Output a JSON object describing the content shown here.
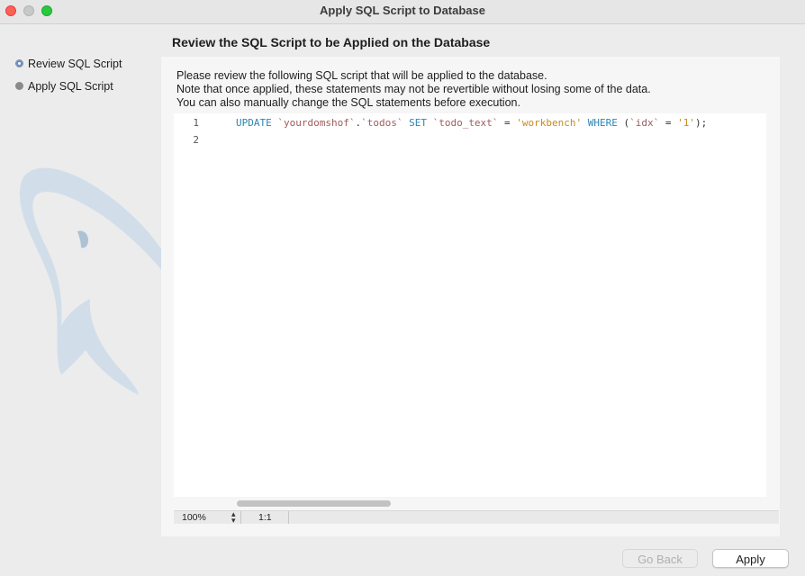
{
  "window": {
    "title": "Apply SQL Script to Database"
  },
  "sidebar": {
    "steps": [
      {
        "label": "Review SQL Script",
        "active": true
      },
      {
        "label": "Apply SQL Script",
        "active": false
      }
    ]
  },
  "main": {
    "heading": "Review the SQL Script to be Applied on the Database",
    "description": [
      "Please review the following SQL script that will be applied to the database.",
      "Note that once applied, these statements may not be revertible without losing some of the data.",
      "You can also manually change the SQL statements before execution."
    ]
  },
  "editor": {
    "line_numbers": [
      "1",
      "2"
    ],
    "tokens": [
      {
        "text": "UPDATE",
        "kind": "keyword"
      },
      {
        "text": " ",
        "kind": "plain"
      },
      {
        "text": "`yourdomshof`",
        "kind": "identifier"
      },
      {
        "text": ".",
        "kind": "plain"
      },
      {
        "text": "`todos`",
        "kind": "identifier"
      },
      {
        "text": " ",
        "kind": "plain"
      },
      {
        "text": "SET",
        "kind": "keyword"
      },
      {
        "text": " ",
        "kind": "plain"
      },
      {
        "text": "`todo_text`",
        "kind": "identifier"
      },
      {
        "text": " = ",
        "kind": "plain"
      },
      {
        "text": "'workbench'",
        "kind": "string"
      },
      {
        "text": " ",
        "kind": "plain"
      },
      {
        "text": "WHERE",
        "kind": "keyword"
      },
      {
        "text": " (",
        "kind": "plain"
      },
      {
        "text": "`idx`",
        "kind": "identifier"
      },
      {
        "text": " = ",
        "kind": "plain"
      },
      {
        "text": "'1'",
        "kind": "string"
      },
      {
        "text": ");",
        "kind": "plain"
      }
    ],
    "horizontal_scroll_fraction": 0.29
  },
  "statusbar": {
    "zoom": "100%",
    "cursor_position": "1:1"
  },
  "buttons": {
    "go_back": "Go Back",
    "apply": "Apply"
  },
  "colors": {
    "keyword": "#2a86b5",
    "identifier": "#a05a5a",
    "string": "#c78a1e",
    "active_step": "#5a8fd8"
  }
}
